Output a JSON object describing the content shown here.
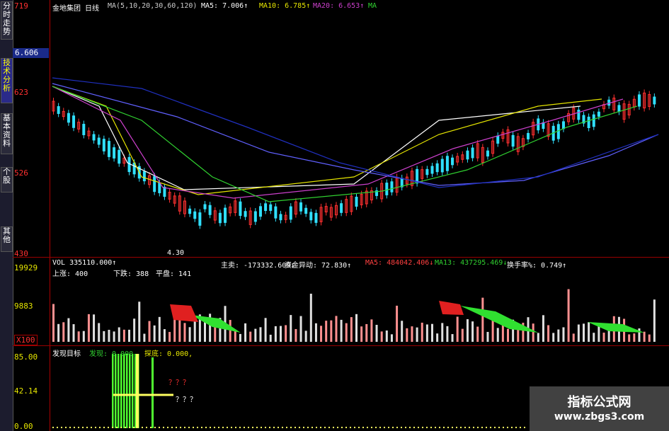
{
  "sidebar": {
    "tabs": [
      {
        "label": "分时走势"
      },
      {
        "label": "技术分析",
        "active": true
      },
      {
        "label": "基本资料"
      },
      {
        "label": "个股"
      },
      {
        "label": "其他"
      }
    ]
  },
  "price_panel": {
    "title": "金地集团 日线",
    "ma_params": "MA(5,10,20,30,60,120)",
    "ma5": "MA5: 7.006↑",
    "ma10": "MA10: 6.785↑",
    "ma20": "MA20: 6.653↑",
    "ma30": "MA",
    "axis": [
      "719",
      "623",
      "526",
      "430"
    ],
    "current_price": "6.606",
    "low_marker": "4.30",
    "colors": {
      "up": "#ff3030",
      "down": "#30e0ff",
      "ma5": "#ffffff",
      "ma10": "#e6e600",
      "ma20": "#cc40cc",
      "ma30": "#30d030",
      "ma60": "#6060ff",
      "ma120": "#2030c0"
    }
  },
  "volume_panel": {
    "vol": "VOL 335110.000↑",
    "zhumai": "主卖: -173332.609↓",
    "zijin": "资金异动: 72.830↑",
    "ma5": "MA5: 484042.406↓",
    "ma13": "MA13: 437295.469↓",
    "huanshou": "换手率%: 0.749↑",
    "axis": [
      "19929",
      "9883"
    ],
    "scale": "X100",
    "shangzhang": "上涨: 400",
    "xiadie": "下跌: 388",
    "pingpan": "平盘: 141"
  },
  "indicator_panel": {
    "title": "发现目标",
    "faxian": "发现: 0.000,",
    "tansuo": "探底: 0.000,",
    "axis": [
      "85.00",
      "42.14",
      "0.00"
    ],
    "note1": "？？？",
    "note2": "？？？"
  },
  "watermark": {
    "line1": "指标公式网",
    "line2": "www.zbgs3.com"
  }
}
